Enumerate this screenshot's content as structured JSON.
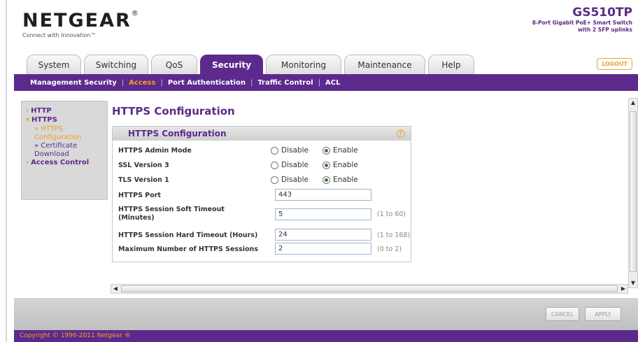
{
  "header": {
    "brand": "NETGEAR",
    "brand_mark": "®",
    "tagline": "Connect with Innovation™",
    "model": "GS510TP",
    "model_desc_line1": "8-Port Gigabit PoE+ Smart Switch",
    "model_desc_line2": "with 2 SFP uplinks",
    "logout_label": "LOGOUT"
  },
  "tabs": [
    {
      "label": "System"
    },
    {
      "label": "Switching"
    },
    {
      "label": "QoS"
    },
    {
      "label": "Security",
      "active": true
    },
    {
      "label": "Monitoring"
    },
    {
      "label": "Maintenance"
    },
    {
      "label": "Help"
    }
  ],
  "subnav": {
    "items": [
      "Management Security",
      "Access",
      "Port Authentication",
      "Traffic Control",
      "ACL"
    ],
    "active": "Access"
  },
  "leftmenu": {
    "http": "HTTP",
    "https": "HTTPS",
    "https_config_1": "» HTTPS",
    "https_config_2": "Configuration",
    "cert_1": "» Certificate",
    "cert_2": "Download",
    "access_control": "Access Control"
  },
  "page_title": "HTTPS Configuration",
  "panel": {
    "title": "HTTPS Configuration",
    "help": "?",
    "admin_mode": {
      "label": "HTTPS Admin Mode",
      "disable": "Disable",
      "enable": "Enable",
      "selected": "Enable"
    },
    "ssl3": {
      "label": "SSL Version 3",
      "disable": "Disable",
      "enable": "Enable",
      "selected": "Enable"
    },
    "tls1": {
      "label": "TLS Version 1",
      "disable": "Disable",
      "enable": "Enable",
      "selected": "Enable"
    },
    "port": {
      "label": "HTTPS Port",
      "value": "443"
    },
    "soft_timeout": {
      "label_1": "HTTPS Session Soft Timeout",
      "label_2": "(Minutes)",
      "value": "5",
      "range": "(1 to 60)"
    },
    "hard_timeout": {
      "label": "HTTPS Session Hard Timeout (Hours)",
      "value": "24",
      "range": "(1 to 168)"
    },
    "max_sessions": {
      "label": "Maximum Number of HTTPS Sessions",
      "value": "2",
      "range": "(0 to 2)"
    }
  },
  "footer": {
    "cancel": "CANCEL",
    "apply": "APPLY",
    "copyright": "Copyright © 1996-2011 Netgear ®"
  }
}
